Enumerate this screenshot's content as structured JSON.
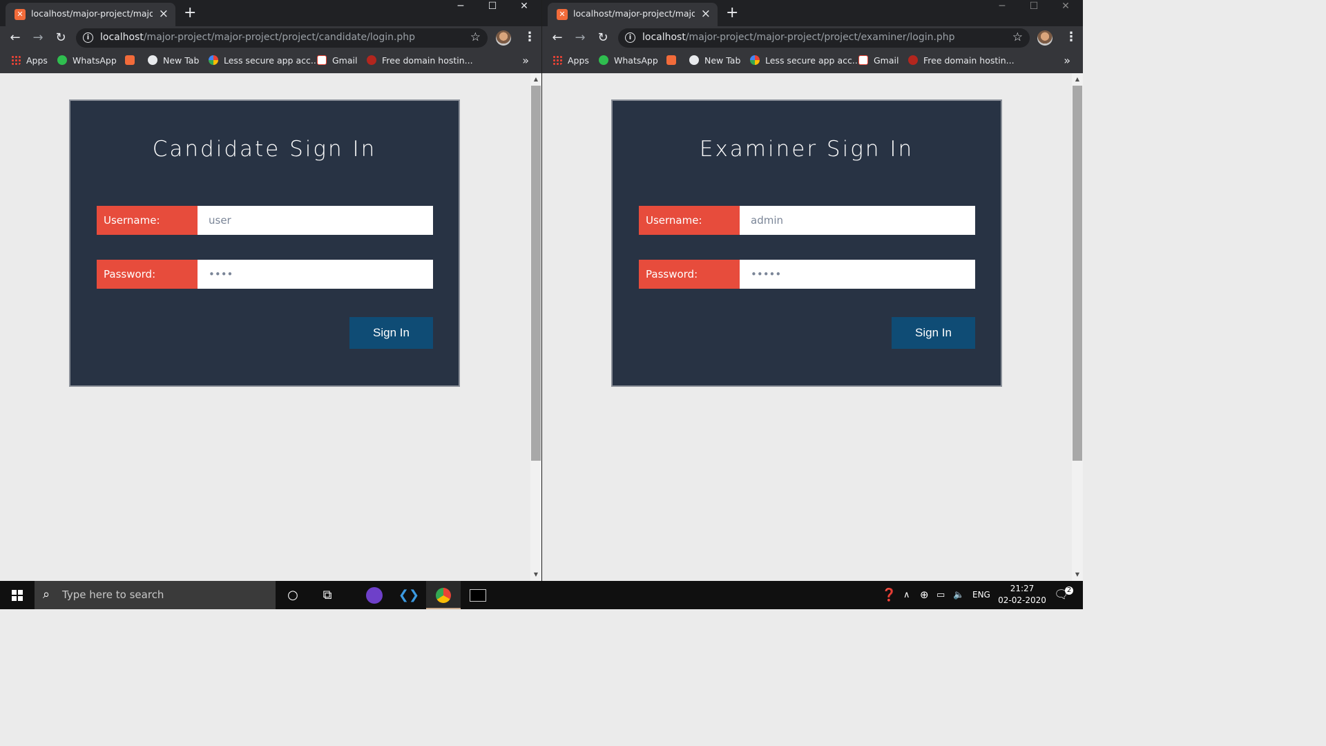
{
  "bookmarks": [
    {
      "label": "Apps",
      "icon": "apps-grid-icon"
    },
    {
      "label": "WhatsApp",
      "icon": "whatsapp-icon"
    },
    {
      "label": "",
      "icon": "xampp-icon"
    },
    {
      "label": "New Tab",
      "icon": "globe-icon"
    },
    {
      "label": "Less secure app acc...",
      "icon": "google-icon"
    },
    {
      "label": "Gmail",
      "icon": "gmail-icon"
    },
    {
      "label": "Free domain hostin...",
      "icon": "hosting-icon"
    }
  ],
  "left_window": {
    "tab_title": "localhost/major-project/major-project",
    "url_host": "localhost",
    "url_path": "/major-project/major-project/project/candidate/login.php",
    "form": {
      "title": "Candidate Sign In",
      "username_label": "Username:",
      "username_value": "user",
      "password_label": "Password:",
      "password_value": "••••",
      "submit_label": "Sign In"
    }
  },
  "right_window": {
    "tab_title": "localhost/major-project/major-project",
    "url_host": "localhost",
    "url_path": "/major-project/major-project/project/examiner/login.php",
    "form": {
      "title": "Examiner Sign In",
      "username_label": "Username:",
      "username_value": "admin",
      "password_label": "Password:",
      "password_value": "•••••",
      "submit_label": "Sign In"
    }
  },
  "taskbar": {
    "search_placeholder": "Type here to search",
    "language": "ENG",
    "time": "21:27",
    "date": "02-02-2020",
    "notification_count": "2"
  },
  "colors": {
    "card_bg": "#283344",
    "label_red": "#e74c3c",
    "button_blue": "#0f4c75",
    "page_bg": "#ebebeb",
    "chrome_dark": "#35363a"
  }
}
